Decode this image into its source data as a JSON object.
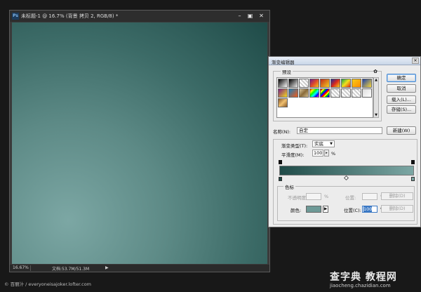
{
  "document": {
    "app_icon": "Ps",
    "title": "未标题-1 @ 16.7% (背景 拷贝 2, RGB/8) *",
    "zoom": "16.67%",
    "doc_size": "文档:53.7M/51.3M",
    "status_arrow": "▶",
    "window_buttons": [
      "–",
      "▣",
      "✕"
    ]
  },
  "dialog": {
    "title": "渐变编辑器",
    "close_glyph": "✕",
    "presets_label": "预设",
    "presets_menu_glyph": "✿",
    "buttons": {
      "ok": "确定",
      "cancel": "取消",
      "load": "载入(L)...",
      "save": "存储(S)..."
    },
    "name_label": "名称(N):",
    "name_value": "自定",
    "new_button": "新建(W)",
    "gradient_type_label": "渐变类型(T):",
    "gradient_type_value": "实底",
    "smoothness_label": "平滑度(M):",
    "smoothness_value": "100",
    "smoothness_unit": "%",
    "stops_label": "色标",
    "opacity_label": "不透明度:",
    "opacity_unit": "%",
    "location_label_disabled": "位置:",
    "location_unit_disabled": "%",
    "delete_label": "删除(D)",
    "color_label": "颜色:",
    "color_arrow": "▶",
    "location_label": "位置(C):",
    "location_value": "100",
    "location_unit": "%",
    "delete_label_2": "删除(D)"
  },
  "colors": {
    "gradient_start": "#1f4b48",
    "gradient_end": "#7ca7a4",
    "selected_stop_color": "#6e9a97"
  },
  "watermark": {
    "left": "© 百丽汁 / everyoneisajoker.lofter.com",
    "site_title": "查字典 教程网",
    "site_url": "jiaocheng.chazidian.com"
  }
}
